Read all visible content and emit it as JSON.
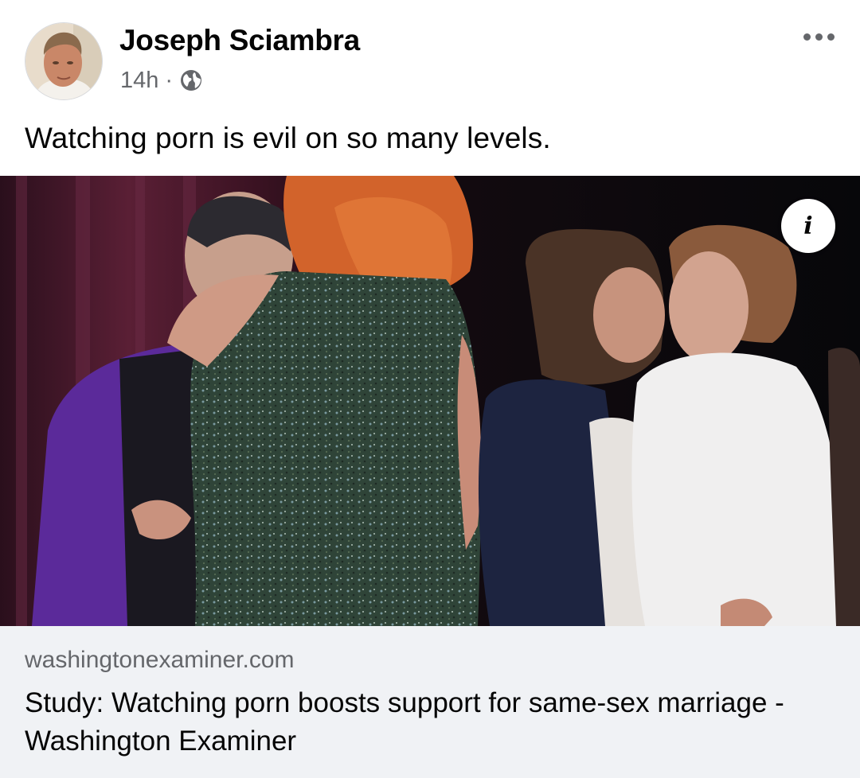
{
  "post": {
    "author": "Joseph Sciambra",
    "time": "14h",
    "separator": "·",
    "privacy_icon": "globe-icon",
    "text": "Watching porn is evil on so many levels."
  },
  "link": {
    "domain": "washingtonexaminer.com",
    "title": "Study: Watching porn boosts support for same-sex marriage - Washington Examiner",
    "info_icon": "info-icon",
    "info_glyph": "i"
  },
  "colors": {
    "text_primary": "#050505",
    "text_secondary": "#65676b",
    "preview_background": "#f0f2f5"
  }
}
